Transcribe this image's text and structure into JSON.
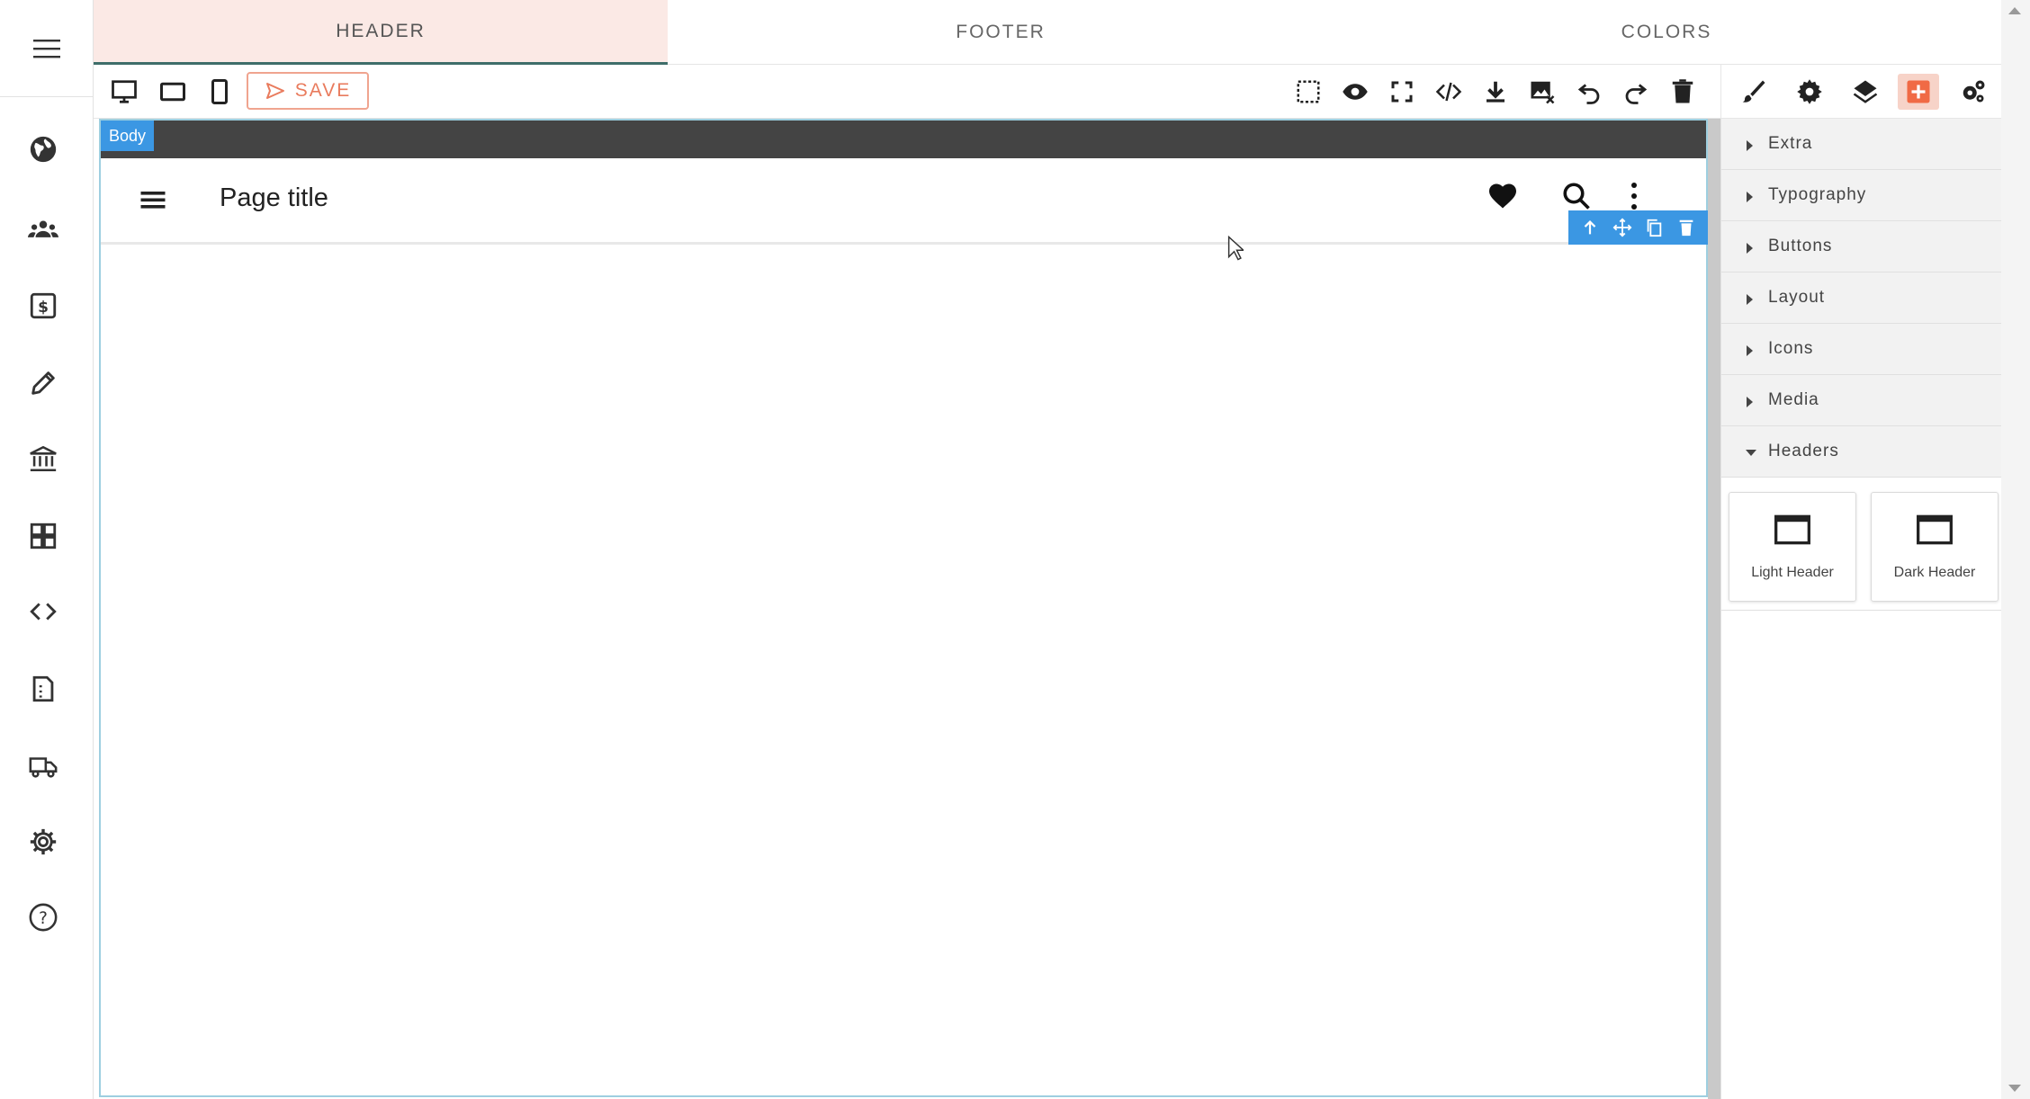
{
  "tabs": [
    {
      "label": "HEADER",
      "active": true
    },
    {
      "label": "FOOTER",
      "active": false
    },
    {
      "label": "COLORS",
      "active": false
    }
  ],
  "toolbar": {
    "save_label": "SAVE"
  },
  "canvas": {
    "body_badge": "Body",
    "page_title": "Page title"
  },
  "panel": {
    "categories": [
      {
        "label": "Extra",
        "open": false
      },
      {
        "label": "Typography",
        "open": false
      },
      {
        "label": "Buttons",
        "open": false
      },
      {
        "label": "Layout",
        "open": false
      },
      {
        "label": "Icons",
        "open": false
      },
      {
        "label": "Media",
        "open": false
      },
      {
        "label": "Headers",
        "open": true
      }
    ],
    "blocks": [
      {
        "label": "Light Header"
      },
      {
        "label": "Dark Header"
      }
    ]
  },
  "colors": {
    "accent": "#e97b5d",
    "active_tab_bg": "#fbe9e5",
    "selection_blue": "#3b97e3",
    "body_bar": "#444444"
  }
}
